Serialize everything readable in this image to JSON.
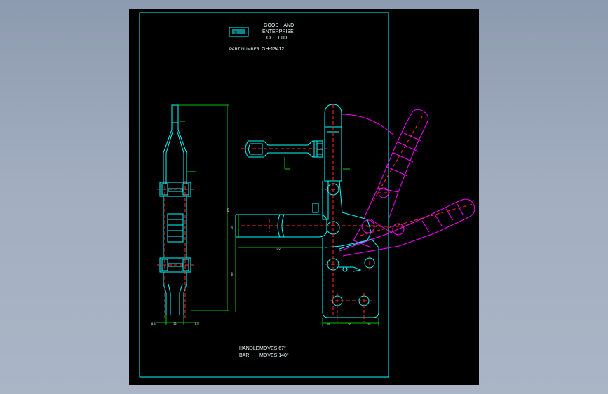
{
  "title_block": {
    "company_line1": "GOOD HAND",
    "company_line2": "ENTERPRISE",
    "company_line3": "CO., LTD.",
    "part_number_label": "PART NUMBER:",
    "part_number": "GH-13412"
  },
  "notes": {
    "handle_label": "HANDLE",
    "handle_text": "MOVES 67°",
    "bar_label": "BAR",
    "bar_text": "MOVES 140°"
  },
  "dimensions": {
    "overall_height": "166",
    "bar_length": "100",
    "bar_height": "25",
    "lower_height": "60",
    "base_w1": "15",
    "base_w2": "30",
    "base_w3": "15",
    "side_w1": "8.5",
    "side_w2": "16",
    "side_w3": "8.5"
  },
  "colors": {
    "background": "#000000",
    "outline": "#00ffff",
    "centerline": "#ff2a2a",
    "dimension": "#00ff00",
    "alternate_position": "#ff00ff",
    "text": "#e8ffff"
  }
}
